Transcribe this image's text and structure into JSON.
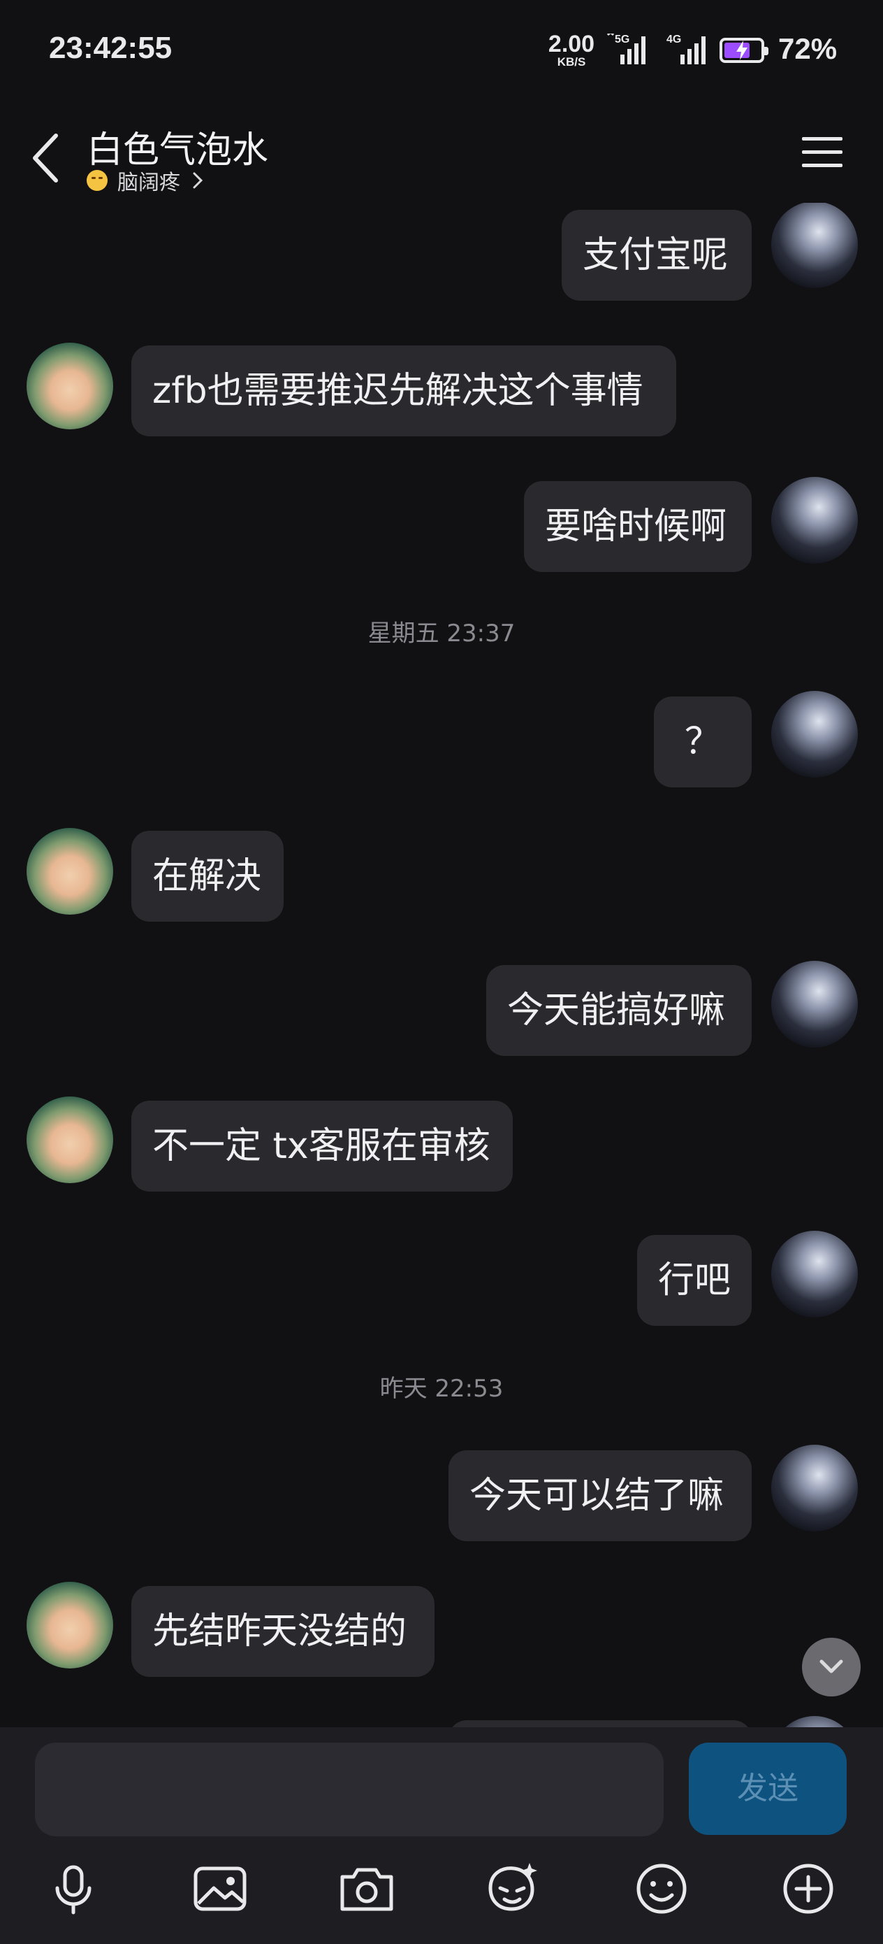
{
  "status_bar": {
    "time": "23:42:55",
    "net_speed_value": "2.00",
    "net_speed_unit": "KB/S",
    "signal1_label": "5G",
    "signal2_label": "4G",
    "battery_percent": "72%",
    "battery_level": 0.72,
    "battery_color": "#9b4dff"
  },
  "header": {
    "title": "白色气泡水",
    "status_text": "脑阔疼",
    "icons": [
      "back-icon",
      "emoji-icon",
      "chevron-right-icon",
      "menu-icon"
    ]
  },
  "messages": [
    {
      "side": "self",
      "text": "支付宝呢"
    },
    {
      "side": "other",
      "text": "zfb也需要推迟先解决这个事情"
    },
    {
      "side": "self",
      "text": "要啥时候啊"
    },
    {
      "timestamp": "星期五 23:37"
    },
    {
      "side": "self",
      "text": "？"
    },
    {
      "side": "other",
      "text": "在解决"
    },
    {
      "side": "self",
      "text": "今天能搞好嘛"
    },
    {
      "side": "other",
      "text": "不一定 tx客服在审核"
    },
    {
      "side": "self",
      "text": "行吧"
    },
    {
      "timestamp": "昨天 22:53"
    },
    {
      "side": "self",
      "text": "今天可以结了嘛"
    },
    {
      "side": "other",
      "text": "先结昨天没结的"
    }
  ],
  "input": {
    "value": "",
    "placeholder": "",
    "send_label": "发送"
  },
  "toolbar": [
    "microphone-icon",
    "image-icon",
    "camera-icon",
    "sticker-icon",
    "smiley-icon",
    "plus-icon"
  ],
  "colors": {
    "background": "#111114",
    "bubble": "#2a2a2e",
    "send_button": "#0e5280"
  }
}
